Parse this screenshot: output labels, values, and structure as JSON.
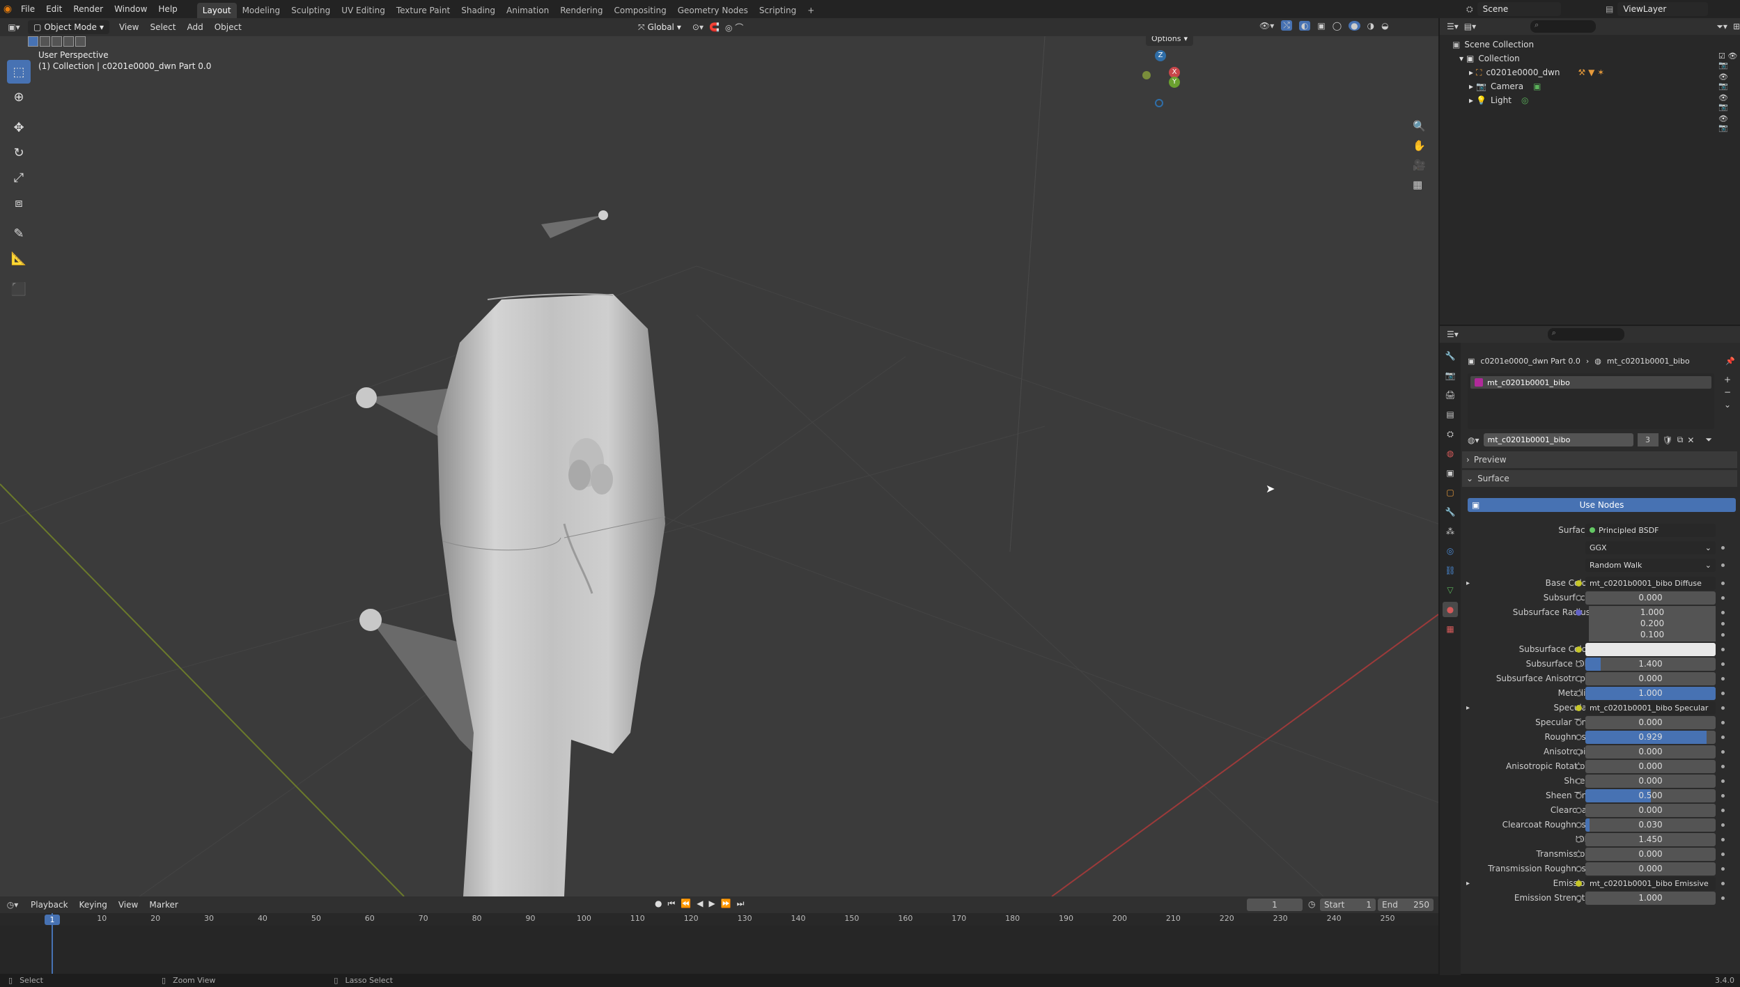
{
  "topbar": {
    "menus": [
      "File",
      "Edit",
      "Render",
      "Window",
      "Help"
    ],
    "workspaces": [
      "Layout",
      "Modeling",
      "Sculpting",
      "UV Editing",
      "Texture Paint",
      "Shading",
      "Animation",
      "Rendering",
      "Compositing",
      "Geometry Nodes",
      "Scripting"
    ],
    "active_workspace": "Layout",
    "scene": "Scene",
    "view_layer": "ViewLayer"
  },
  "viewport_header": {
    "mode": "Object Mode",
    "menus": [
      "View",
      "Select",
      "Add",
      "Object"
    ],
    "transform_orientation": "Global",
    "options": "Options"
  },
  "viewport": {
    "view_name": "User Perspective",
    "collection_info": "(1) Collection | c0201e0000_dwn Part 0.0",
    "gizmo_z": "Z",
    "gizmo_x": "X",
    "gizmo_y": "Y"
  },
  "outliner": {
    "root": "Scene Collection",
    "collection": "Collection",
    "items": [
      {
        "name": "c0201e0000_dwn"
      },
      {
        "name": "Camera"
      },
      {
        "name": "Light"
      }
    ]
  },
  "properties": {
    "breadcrumb_object": "c0201e0000_dwn Part 0.0",
    "breadcrumb_material": "mt_c0201b0001_bibo",
    "slot_name": "mt_c0201b0001_bibo",
    "material_name": "mt_c0201b0001_bibo",
    "user_count": "3",
    "panel_preview": "Preview",
    "panel_surface": "Surface",
    "use_nodes": "Use Nodes",
    "surface_label": "Surface",
    "surface_value": "Principled BSDF",
    "distribution": "GGX",
    "subsurface_method": "Random Walk",
    "rows": [
      {
        "label": "Base Color",
        "link": "mt_c0201b0001_bibo Diffuse"
      },
      {
        "label": "Subsurface",
        "value": "0.000",
        "fill": 0
      },
      {
        "label": "Subsurface Radius",
        "value": "1.000",
        "fill": 0
      },
      {
        "label": "",
        "value": "0.200",
        "fill": 0
      },
      {
        "label": "",
        "value": "0.100",
        "fill": 0
      },
      {
        "label": "Subsurface Color",
        "color": "#e8e8e8"
      },
      {
        "label": "Subsurface IOR",
        "value": "1.400",
        "fill": 0.12
      },
      {
        "label": "Subsurface Anisotropy",
        "value": "0.000",
        "fill": 0
      },
      {
        "label": "Metallic",
        "value": "1.000",
        "fill": 1
      },
      {
        "label": "Specular",
        "link": "mt_c0201b0001_bibo Specular"
      },
      {
        "label": "Specular Tint",
        "value": "0.000",
        "fill": 0
      },
      {
        "label": "Roughness",
        "value": "0.929",
        "fill": 0.929
      },
      {
        "label": "Anisotropic",
        "value": "0.000",
        "fill": 0
      },
      {
        "label": "Anisotropic Rotation",
        "value": "0.000",
        "fill": 0
      },
      {
        "label": "Sheen",
        "value": "0.000",
        "fill": 0
      },
      {
        "label": "Sheen Tint",
        "value": "0.500",
        "fill": 0.5
      },
      {
        "label": "Clearcoat",
        "value": "0.000",
        "fill": 0
      },
      {
        "label": "Clearcoat Roughness",
        "value": "0.030",
        "fill": 0.03
      },
      {
        "label": "IOR",
        "value": "1.450",
        "fill": 0
      },
      {
        "label": "Transmission",
        "value": "0.000",
        "fill": 0
      },
      {
        "label": "Transmission Roughness",
        "value": "0.000",
        "fill": 0
      },
      {
        "label": "Emission",
        "link": "mt_c0201b0001_bibo Emissive"
      },
      {
        "label": "Emission Strength",
        "value": "1.000",
        "fill": 0
      }
    ]
  },
  "timeline": {
    "menus": [
      "Playback",
      "Keying",
      "View",
      "Marker"
    ],
    "current_frame": "1",
    "start_label": "Start",
    "start": "1",
    "end_label": "End",
    "end": "250",
    "ticks": [
      "1",
      "10",
      "20",
      "30",
      "40",
      "50",
      "60",
      "70",
      "80",
      "90",
      "100",
      "110",
      "120",
      "130",
      "140",
      "150",
      "160",
      "170",
      "180",
      "190",
      "200",
      "210",
      "220",
      "230",
      "240",
      "250"
    ]
  },
  "status": {
    "select": "Select",
    "zoom": "Zoom View",
    "lasso": "Lasso Select",
    "version": "3.4.0"
  },
  "colors": {
    "accent": "#4772b3",
    "header": "#303030",
    "viewport": "#3b3b3b"
  }
}
